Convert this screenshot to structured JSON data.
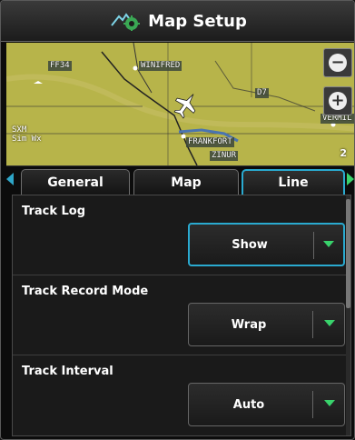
{
  "header": {
    "title": "Map Setup",
    "icon": "map-setup-icon"
  },
  "map": {
    "labels": {
      "top_left_airport": "FF34",
      "town_winifred": "WINIFRED",
      "airport_right": "D7",
      "town_frankfort": "FRANKFORT",
      "zinur": "ZINUR",
      "vermil": "VERMIL"
    },
    "overlay": {
      "line1": "SXM",
      "line2": "Sim Wx"
    },
    "scale": "2",
    "zoom_out_symbol": "−",
    "zoom_in_symbol": "+",
    "colors": {
      "terrain": "#b7b44a",
      "lake": "#4a74b0",
      "route": "#222222"
    }
  },
  "tabs": [
    {
      "label": "General",
      "active": false
    },
    {
      "label": "Map",
      "active": false
    },
    {
      "label": "Line",
      "active": true
    }
  ],
  "settings": [
    {
      "label": "Track Log",
      "value": "Show",
      "focused": true
    },
    {
      "label": "Track Record Mode",
      "value": "Wrap",
      "focused": false
    },
    {
      "label": "Track Interval",
      "value": "Auto",
      "focused": false
    }
  ],
  "colors": {
    "accent": "#2aaad0",
    "chevron": "#39d36c",
    "background": "#0c0c0c"
  }
}
